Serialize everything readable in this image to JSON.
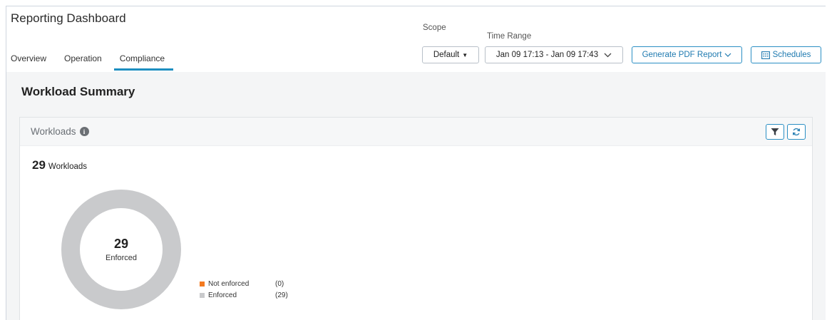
{
  "app": {
    "title": "Reporting Dashboard"
  },
  "tabs": [
    {
      "label": "Overview",
      "active": false
    },
    {
      "label": "Operation",
      "active": false
    },
    {
      "label": "Compliance",
      "active": true
    }
  ],
  "controls": {
    "scope_label": "Scope",
    "scope_value": "Default",
    "time_range_label": "Time Range",
    "time_range_value": "Jan 09 17:13 - Jan 09 17:43",
    "generate_pdf_label": "Generate PDF Report",
    "schedules_label": "Schedules"
  },
  "summary": {
    "section_title": "Workload Summary",
    "card_title": "Workloads",
    "count": "29",
    "count_unit": "Workloads"
  },
  "colors": {
    "accent": "#1d8ec0",
    "not_enforced": "#f47a20",
    "enforced": "#c9cacc"
  },
  "chart_data": {
    "type": "pie",
    "donut": true,
    "center_value": "29",
    "center_label": "Enforced",
    "categories": [
      "Not enforced",
      "Enforced"
    ],
    "values": [
      0,
      29
    ],
    "legend_counts": [
      "(0)",
      "(29)"
    ]
  }
}
